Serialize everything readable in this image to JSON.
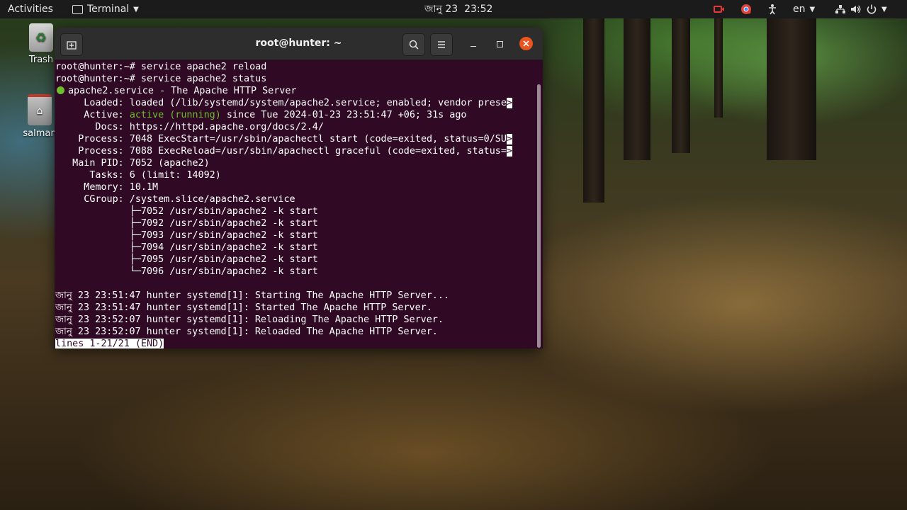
{
  "topbar": {
    "activities": "Activities",
    "app_name": "Terminal",
    "clock": "জানু 23  23:52",
    "language": "en"
  },
  "desktop": {
    "trash_label": "Trash",
    "home_label": "salman"
  },
  "terminal": {
    "title": "root@hunter: ~",
    "lines": [
      "root@hunter:~# service apache2 reload",
      "root@hunter:~# service apache2 status",
      "apache2.service - The Apache HTTP Server",
      "     Loaded: loaded (/lib/systemd/system/apache2.service; enabled; vendor prese",
      "     Active: ",
      "       Docs: https://httpd.apache.org/docs/2.4/",
      "    Process: 7048 ExecStart=/usr/sbin/apachectl start (code=exited, status=0/SU",
      "    Process: 7088 ExecReload=/usr/sbin/apachectl graceful (code=exited, status=",
      "   Main PID: 7052 (apache2)",
      "      Tasks: 6 (limit: 14092)",
      "     Memory: 10.1M",
      "     CGroup: /system.slice/apache2.service",
      "             ├─7052 /usr/sbin/apache2 -k start",
      "             ├─7092 /usr/sbin/apache2 -k start",
      "             ├─7093 /usr/sbin/apache2 -k start",
      "             ├─7094 /usr/sbin/apache2 -k start",
      "             ├─7095 /usr/sbin/apache2 -k start",
      "             └─7096 /usr/sbin/apache2 -k start",
      "",
      "জানু 23 23:51:47 hunter systemd[1]: Starting The Apache HTTP Server...",
      "জানু 23 23:51:47 hunter systemd[1]: Started The Apache HTTP Server.",
      "জানু 23 23:52:07 hunter systemd[1]: Reloading The Apache HTTP Server.",
      "জানু 23 23:52:07 hunter systemd[1]: Reloaded The Apache HTTP Server."
    ],
    "active_status": "active (running)",
    "active_rest": " since Tue 2024-01-23 23:51:47 +06; 31s ago",
    "truncation_marker": ">",
    "status_line": "lines 1-21/21 (END)"
  },
  "colors": {
    "terminal_bg": "#300a24",
    "status_green": "#6cbf2b",
    "close_button": "#e95420"
  },
  "icons": [
    "new-tab-icon",
    "search-icon",
    "menu-icon",
    "minimize-icon",
    "maximize-icon",
    "close-icon",
    "trash-icon",
    "home-folder-icon",
    "terminal-app-icon",
    "screen-record-icon",
    "chrome-icon",
    "accessibility-icon",
    "network-icon",
    "volume-icon",
    "power-icon"
  ]
}
